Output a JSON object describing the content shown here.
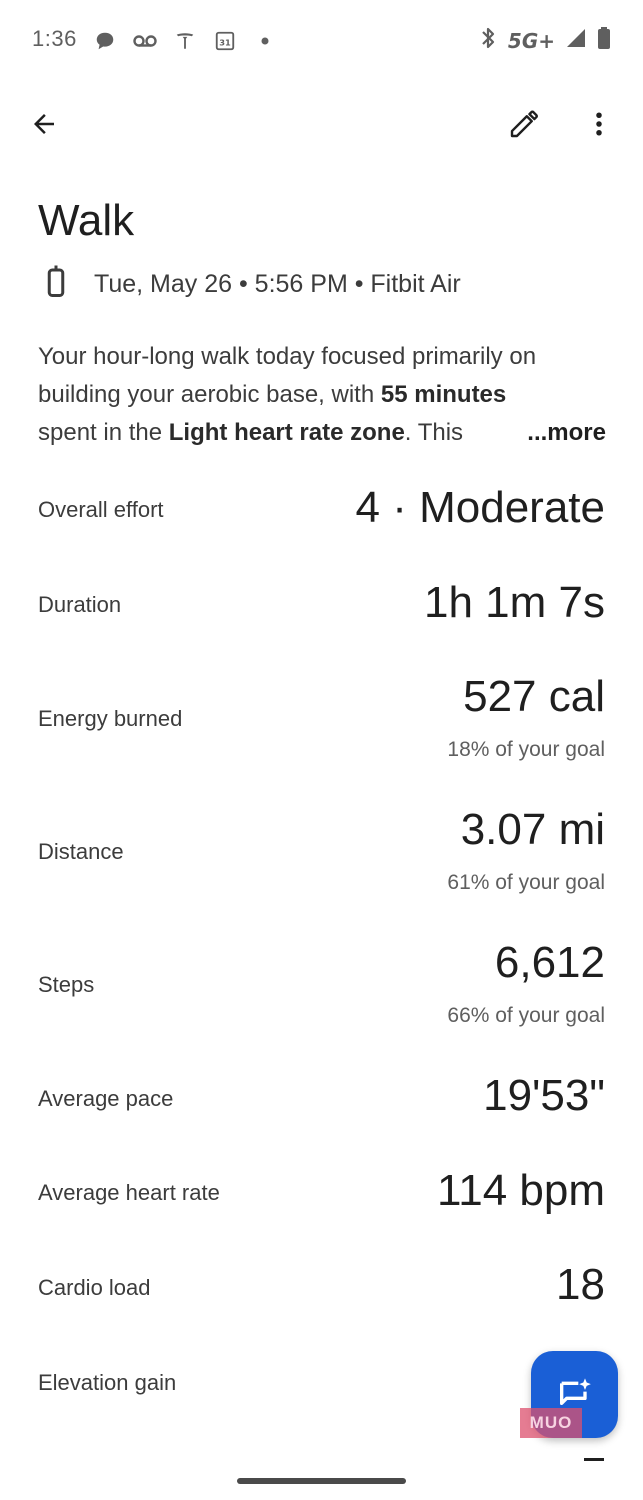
{
  "status_bar": {
    "time": "1:36",
    "network": "5G+",
    "left_icons": [
      "chat-bubble-icon",
      "voicemail-icon",
      "tesla-icon",
      "calendar-icon",
      "dot-icon"
    ],
    "right_icons": [
      "bluetooth-icon",
      "signal-icon",
      "battery-icon"
    ],
    "calendar_day": "31"
  },
  "app_bar": {
    "back_icon": "arrow-back-icon",
    "edit_icon": "pencil-icon",
    "more_icon": "more-vert-icon"
  },
  "activity": {
    "title": "Walk",
    "meta": "Tue, May 26 • 5:56 PM • Fitbit Air",
    "device_icon": "fitness-tracker-icon"
  },
  "summary": {
    "line1": "Your hour-long walk today focused primarily on",
    "line2_a": "building your aerobic base, with ",
    "line2_b": "55 minutes",
    "line3_a": "spent in the ",
    "line3_b": "Light heart rate zone",
    "line3_c": ". This",
    "more": "...more"
  },
  "metrics": [
    {
      "label": "Overall effort",
      "value": "4 · Moderate",
      "sub": ""
    },
    {
      "label": "Duration",
      "value": "1h 1m 7s",
      "sub": ""
    },
    {
      "label": "Energy burned",
      "value": "527 cal",
      "sub": "18% of your goal"
    },
    {
      "label": "Distance",
      "value": "3.07 mi",
      "sub": "61% of your goal"
    },
    {
      "label": "Steps",
      "value": "6,612",
      "sub": "66% of your goal"
    },
    {
      "label": "Average pace",
      "value": "19'53\"",
      "sub": ""
    },
    {
      "label": "Average heart rate",
      "value": "114 bpm",
      "sub": ""
    },
    {
      "label": "Cardio load",
      "value": "18",
      "sub": ""
    },
    {
      "label": "Elevation gain",
      "value": "",
      "sub": ""
    }
  ],
  "fab": {
    "icon": "ai-chat-sparkle-icon",
    "color": "#1a5fd6"
  },
  "watermark": "MUO"
}
